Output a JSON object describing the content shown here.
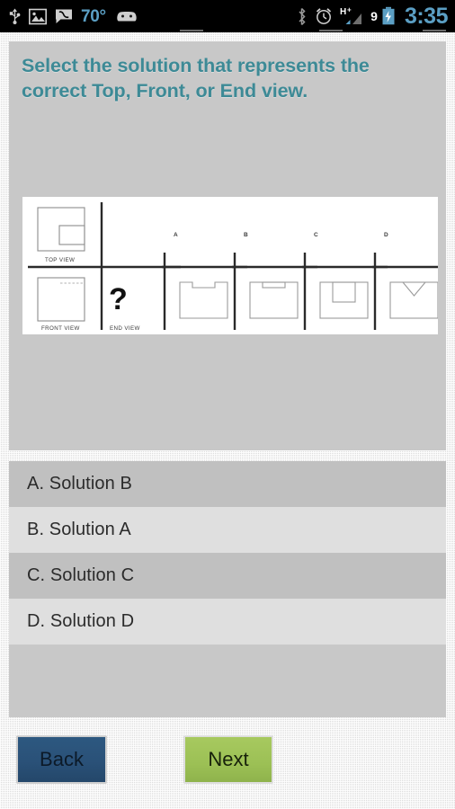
{
  "status_bar": {
    "left_icons": [
      "usb-icon",
      "image-icon",
      "voicemail-icon",
      "android-face-icon"
    ],
    "temperature": "70°",
    "right_icons": [
      "bluetooth-icon",
      "alarm-clock-icon",
      "signal-hplus-icon",
      "battery-icon"
    ],
    "network_type": "H+",
    "battery_level": "9",
    "time": "3:35"
  },
  "question": {
    "text": "Select the solution that represents the correct Top, Front, or End view.",
    "text_color": "#3d8a96"
  },
  "diagram": {
    "labels": {
      "top_view": "TOP VIEW",
      "front_view": "FRONT VIEW",
      "end_view": "END VIEW",
      "unknown_marker": "?"
    },
    "choice_labels": [
      "A",
      "B",
      "C",
      "D"
    ],
    "choice_descriptions": [
      "square with rectangular notch cut into top edge",
      "square with small rectangle inset at top center",
      "square with tall rectangle from top edge to middle",
      "square with V-notch at top center"
    ]
  },
  "options": [
    {
      "label": "A. Solution B",
      "shade": "dark"
    },
    {
      "label": "B. Solution A",
      "shade": "light"
    },
    {
      "label": "C. Solution C",
      "shade": "dark"
    },
    {
      "label": "D. Solution D",
      "shade": "light"
    }
  ],
  "buttons": {
    "back": "Back",
    "next": "Next",
    "back_color": "#2a5178",
    "next_color": "#9cc055"
  }
}
